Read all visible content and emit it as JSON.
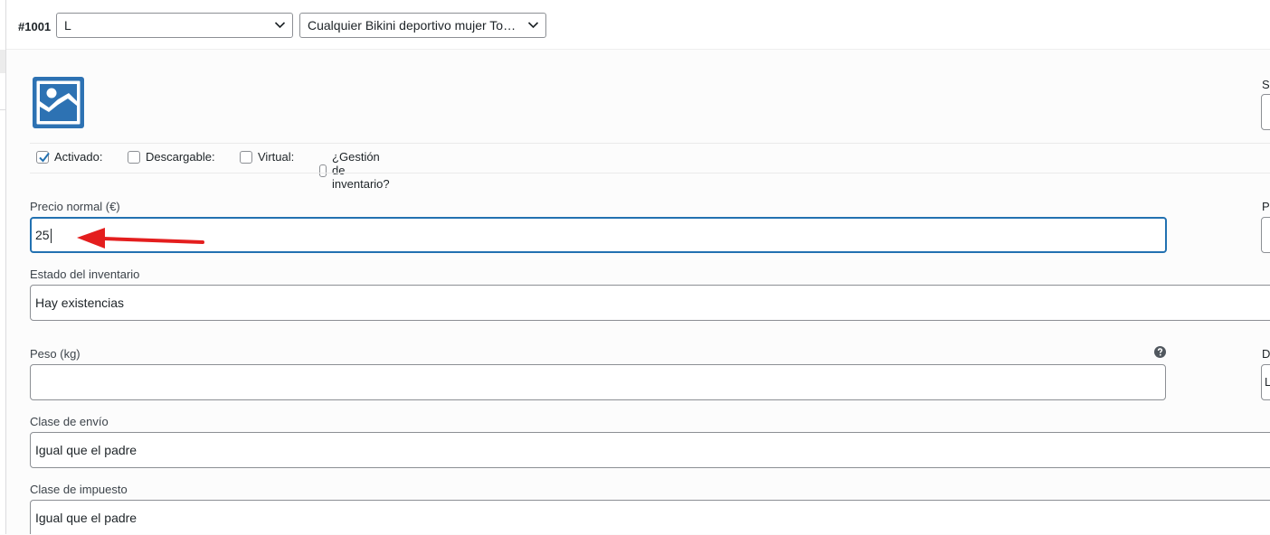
{
  "variation": {
    "id_label": "#1001",
    "size_select": "L",
    "product_select": "Cualquier Bikini deportivo mujer Top…"
  },
  "options": {
    "enabled": {
      "label": "Activado:",
      "checked": true
    },
    "downloadable": {
      "label": "Descargable:",
      "checked": false
    },
    "virtual": {
      "label": "Virtual:",
      "checked": false
    },
    "manage_stock": {
      "label": "¿Gestión de inventario?",
      "checked": false
    }
  },
  "right_column_cutoff": {
    "label1": "Sl",
    "label2": "Pr",
    "label3": "D",
    "value3": "L"
  },
  "fields": {
    "regular_price": {
      "label": "Precio normal (€)",
      "value": "25"
    },
    "stock_status": {
      "label": "Estado del inventario",
      "value": "Hay existencias"
    },
    "weight": {
      "label": "Peso (kg)",
      "value": ""
    },
    "shipping_class": {
      "label": "Clase de envío",
      "value": "Igual que el padre"
    },
    "tax_class": {
      "label": "Clase de impuesto",
      "value": "Igual que el padre"
    }
  },
  "icons": {
    "thumbnail": "image-placeholder-icon",
    "help": "help-icon",
    "chevron": "chevron-down-icon",
    "annotation": "arrow-annotation"
  },
  "colors": {
    "accent": "#2271b1",
    "annotation_arrow": "#e41e1e",
    "check": "#2271b1"
  }
}
